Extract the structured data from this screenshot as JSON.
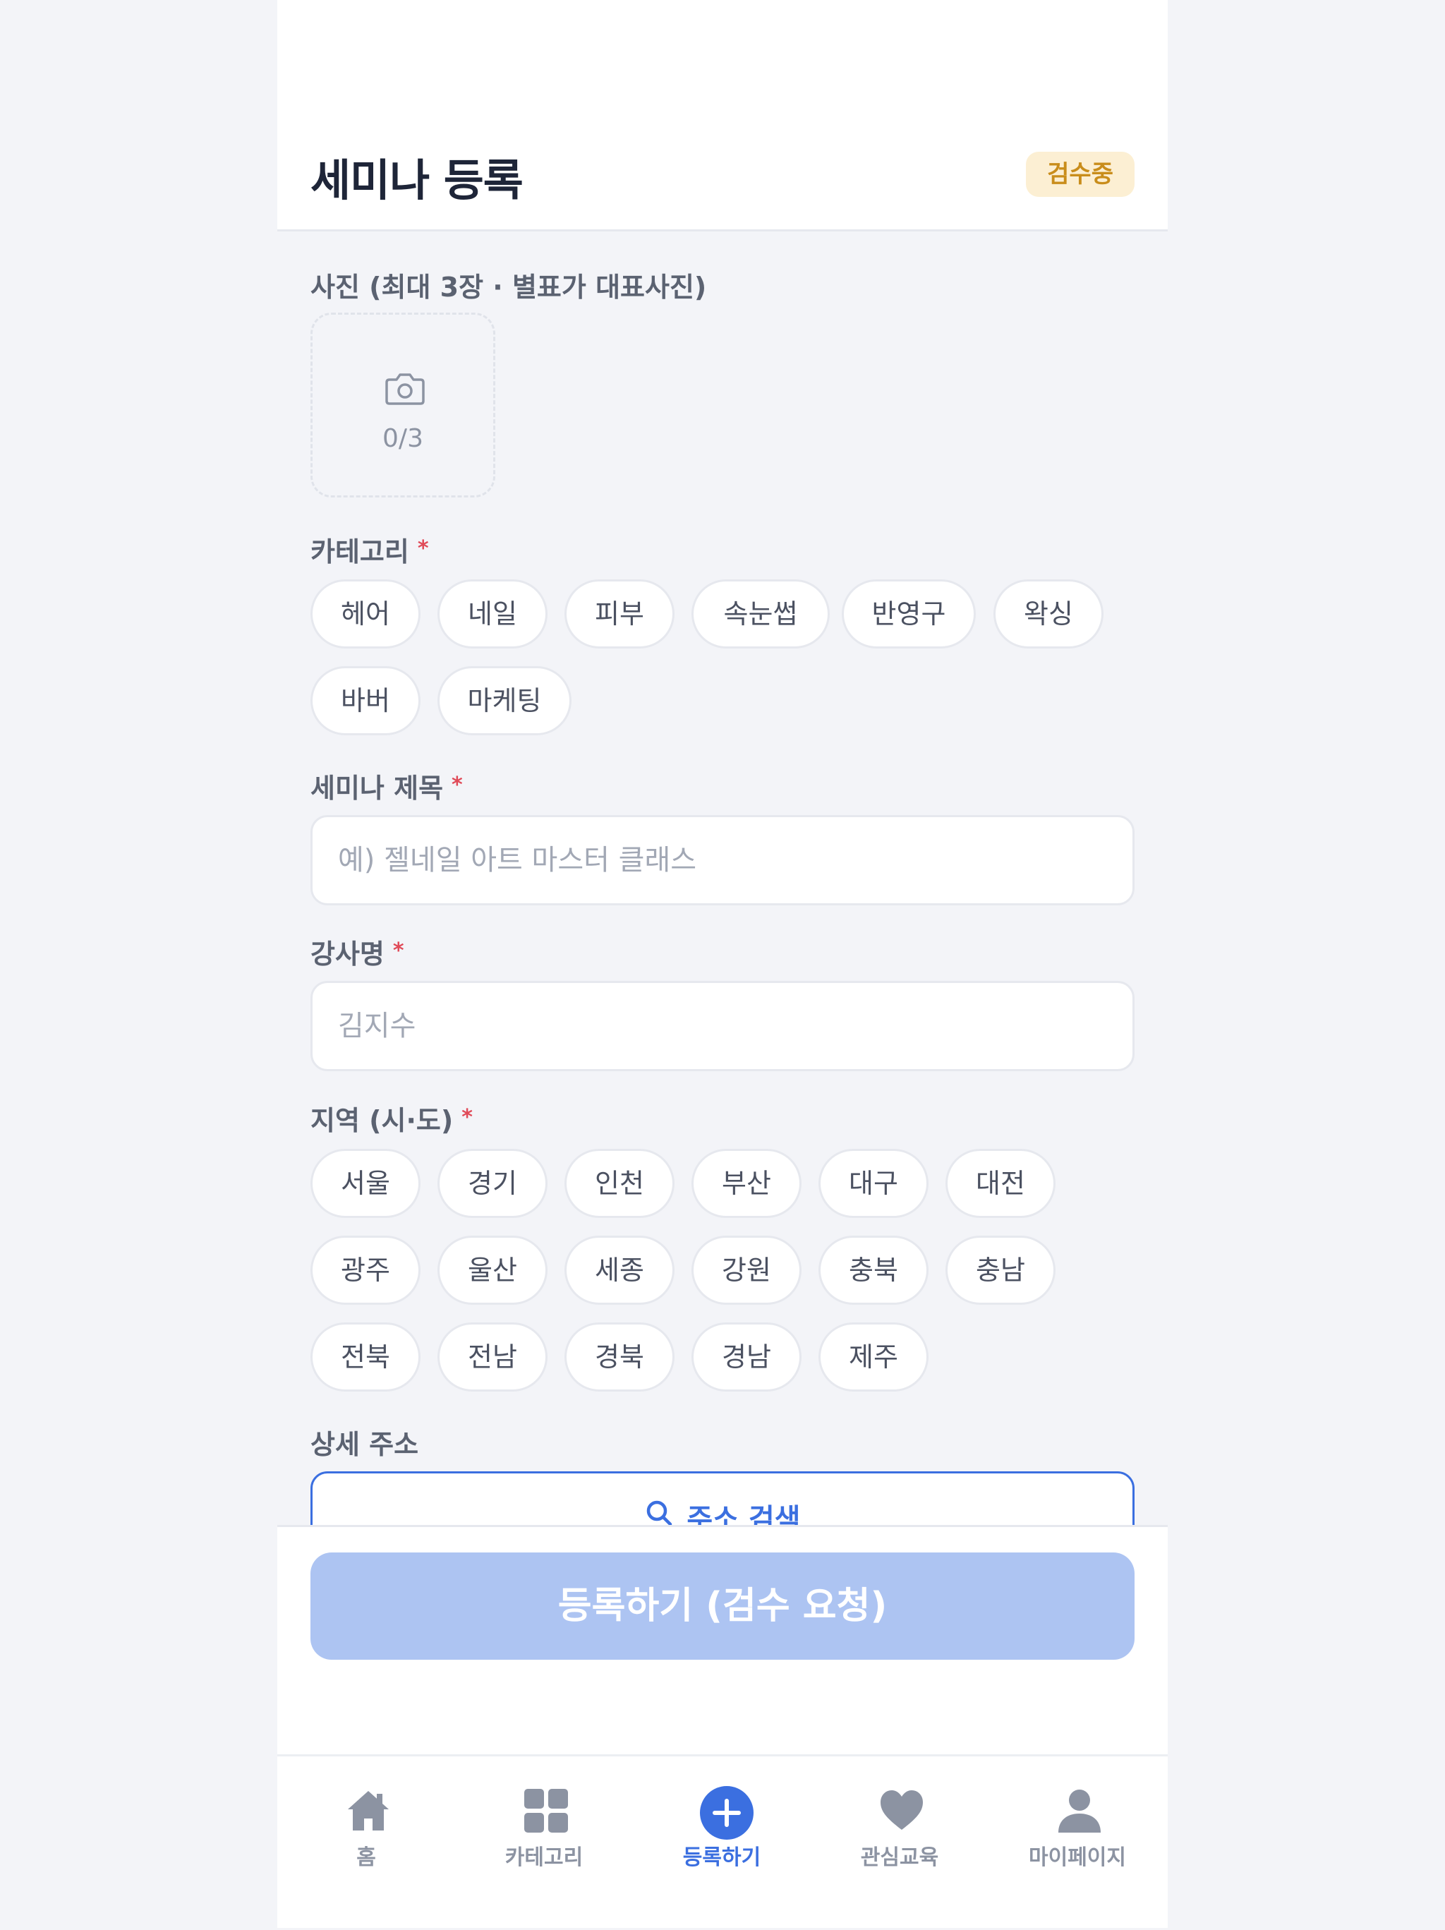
{
  "header": {
    "title": "세미나 등록",
    "status_badge": "검수중"
  },
  "photo": {
    "label": "사진 (최대 3장 · 별표가 대표사진)",
    "count": "0/3",
    "icon": "camera-icon"
  },
  "category": {
    "label": "카테고리",
    "required_mark": "*",
    "options": [
      "헤어",
      "네일",
      "피부",
      "속눈썹",
      "반영구",
      "왁싱",
      "바버",
      "마케팅"
    ]
  },
  "title_field": {
    "label": "세미나 제목",
    "required_mark": "*",
    "value": "",
    "placeholder": "예) 젤네일 아트 마스터 클래스"
  },
  "instructor_field": {
    "label": "강사명",
    "required_mark": "*",
    "value": "",
    "placeholder": "김지수"
  },
  "region": {
    "label": "지역 (시·도)",
    "required_mark": "*",
    "options": [
      "서울",
      "경기",
      "인천",
      "부산",
      "대구",
      "대전",
      "광주",
      "울산",
      "세종",
      "강원",
      "충북",
      "충남",
      "전북",
      "전남",
      "경북",
      "경남",
      "제주"
    ]
  },
  "address": {
    "label": "상세 주소",
    "search_button": "주소 검색",
    "icon": "search-icon"
  },
  "submit": {
    "label": "등록하기 (검수 요청)"
  },
  "tabbar": {
    "items": [
      {
        "label": "홈",
        "icon": "home-icon",
        "active": false
      },
      {
        "label": "카테고리",
        "icon": "grid-icon",
        "active": false
      },
      {
        "label": "등록하기",
        "icon": "plus-circle-icon",
        "active": true
      },
      {
        "label": "관심교육",
        "icon": "heart-icon",
        "active": false
      },
      {
        "label": "마이페이지",
        "icon": "user-icon",
        "active": false
      }
    ]
  },
  "colors": {
    "accent": "#3b6fe0",
    "submit_disabled": "#adc4f2",
    "badge_bg": "#fcefd3",
    "badge_text": "#c98d1b",
    "required": "#e04a58",
    "background": "#f3f4f8"
  }
}
